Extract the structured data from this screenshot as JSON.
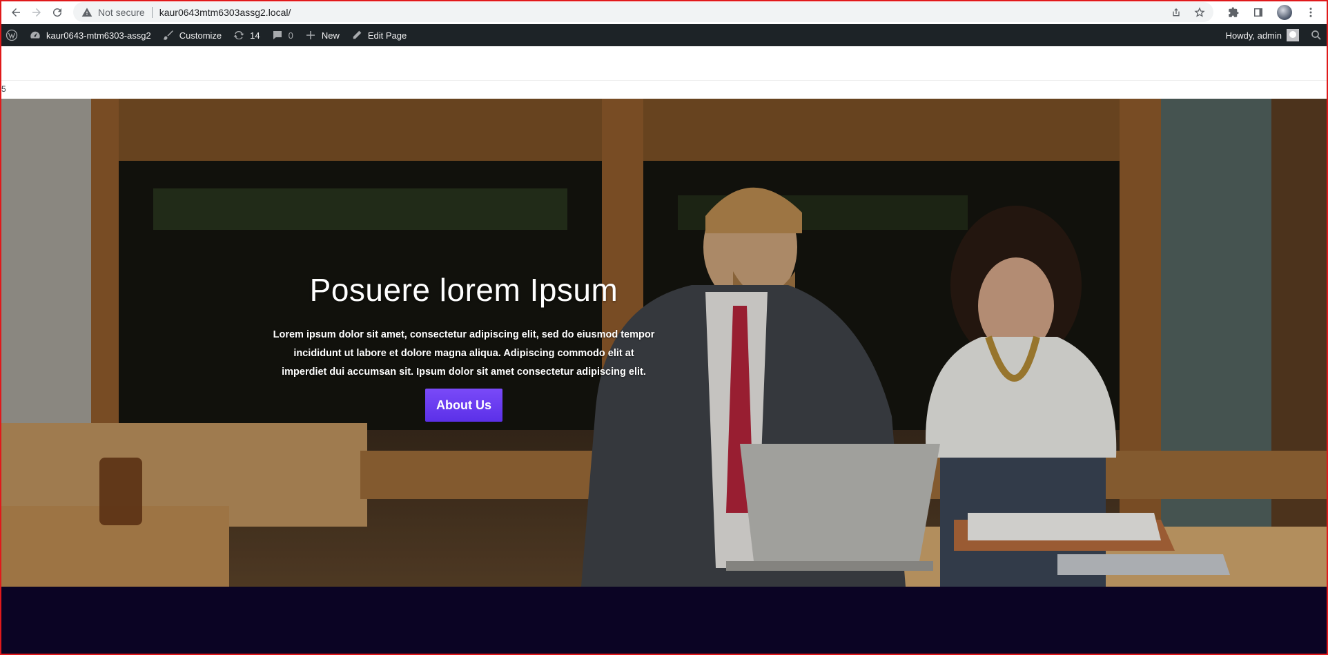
{
  "browser": {
    "security_label": "Not secure",
    "url": "kaur0643mtm6303assg2.local/"
  },
  "adminbar": {
    "site_name": "kaur0643-mtm6303-assg2",
    "customize": "Customize",
    "updates_count": "14",
    "comments_count": "0",
    "new_label": "New",
    "edit_page": "Edit Page",
    "howdy": "Howdy, admin"
  },
  "page": {
    "stray_text": "5"
  },
  "hero": {
    "title": "Posuere lorem Ipsum",
    "text": "Lorem ipsum dolor sit amet, consectetur adipiscing elit, sed do eiusmod tempor incididunt ut labore et dolore magna aliqua. Adipiscing commodo elit at imperdiet dui accumsan sit. Ipsum dolor sit amet consectetur adipiscing elit.",
    "button": "About Us"
  },
  "colors": {
    "button": "#6a3cf3",
    "adminbar": "#1d2327",
    "footer": "#0b0424"
  }
}
